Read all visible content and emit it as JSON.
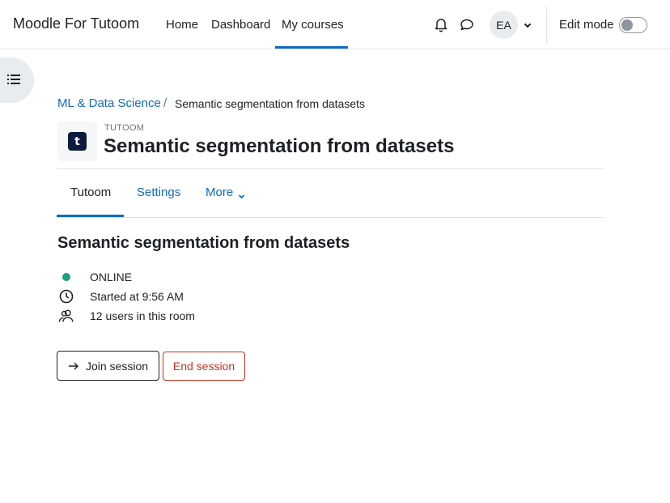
{
  "navbar": {
    "brand": "Moodle For Tutoom",
    "links": [
      {
        "label": "Home"
      },
      {
        "label": "Dashboard"
      },
      {
        "label": "My courses"
      }
    ],
    "avatar_initials": "EA",
    "edit_mode_label": "Edit mode",
    "edit_mode_on": false
  },
  "breadcrumb": {
    "parent": "ML & Data Science",
    "separator": "/",
    "current": "Semantic segmentation from datasets"
  },
  "header": {
    "icon_letter": "t",
    "module_type": "TUTOOM",
    "title": "Semantic segmentation from datasets"
  },
  "secondary_nav": {
    "tabs": [
      {
        "label": "Tutoom"
      },
      {
        "label": "Settings"
      },
      {
        "label": "More"
      }
    ]
  },
  "session": {
    "title": "Semantic segmentation from datasets",
    "status": "ONLINE",
    "started": "Started at 9:56 AM",
    "users": "12 users in this room",
    "join_label": "Join session",
    "end_label": "End session"
  },
  "colors": {
    "accent": "#0f6cbf",
    "online": "#1a9e85",
    "danger": "#ca3120"
  }
}
